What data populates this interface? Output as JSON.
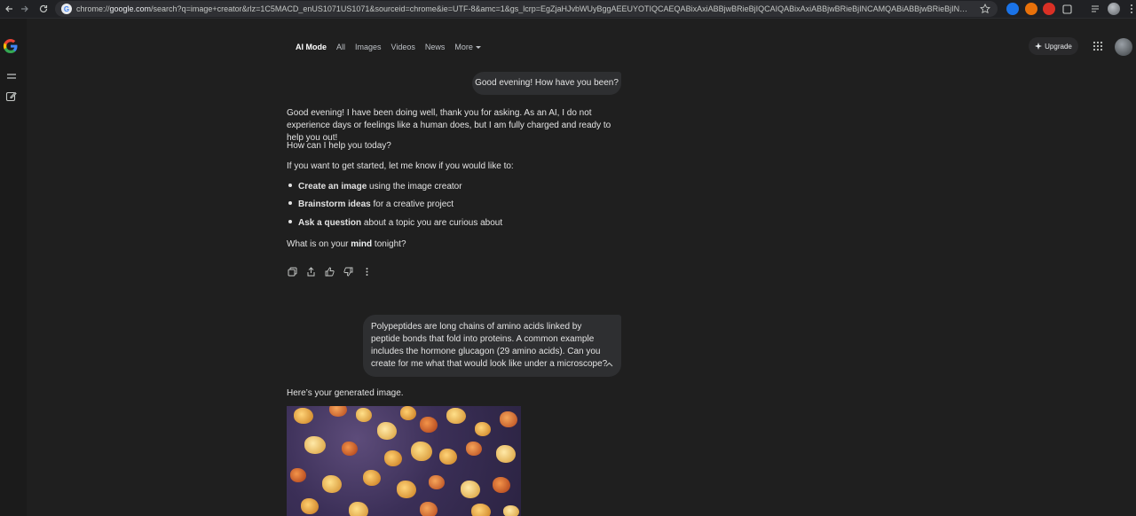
{
  "browser": {
    "url_prefix": "chrome://",
    "url_host": "google.com",
    "url_rest": "/search?q=image+creator&rlz=1C5MACD_enUS1071US1071&sourceid=chrome&ie=UTF-8&amc=1&gs_lcrp=EgZjaHJvbWUyBggAEEUYOTIQCAEQABixAxiABBjwBRieBjIQCAIQABixAxiABBjwBRieBjINCAMQABiABBjwBRieBjINCAQQABiABBjwBRieBjI..."
  },
  "tabs": [
    {
      "label": "AI Mode",
      "active": true
    },
    {
      "label": "All"
    },
    {
      "label": "Images"
    },
    {
      "label": "Videos"
    },
    {
      "label": "News"
    },
    {
      "label": "More"
    }
  ],
  "header": {
    "upgrade_label": "Upgrade"
  },
  "chat": {
    "user_msg_1": "Good evening! How have you been?",
    "resp_1_p1": "Good evening! I have been doing well, thank you for asking. As an AI, I do not experience days or feelings like a human does, but I am fully charged and ready to help you out!",
    "resp_1_p2": "How can I help you today?",
    "resp_1_p3": "If you want to get started, let me know if you would like to:",
    "list": [
      {
        "bold": "Create an image",
        "rest": " using the image creator"
      },
      {
        "bold": "Brainstorm ideas",
        "rest": " for a creative project"
      },
      {
        "bold": "Ask a question",
        "rest": " about a topic you are curious about"
      }
    ],
    "resp_1_p4_a": "What is on your ",
    "resp_1_p4_b": "mind",
    "resp_1_p4_c": " tonight?",
    "user_msg_2": "Polypeptides are long chains of amino acids linked by peptide bonds that fold into proteins. A common example includes the hormone glucagon (29 amino acids). Can you create for me what that would look like under a microscope?",
    "resp_2": "Here’s your generated image."
  },
  "icons": {
    "back": "arrow-left-icon",
    "forward": "arrow-right-icon",
    "reload": "reload-icon",
    "star": "star-icon",
    "menu": "menu-icon",
    "new_chat": "edit-icon",
    "copy": "copy-icon",
    "share": "share-icon",
    "thumbs_up": "thumbs-up-icon",
    "thumbs_down": "thumbs-down-icon",
    "more": "more-vert-icon",
    "apps": "apps-grid-icon"
  },
  "colors": {
    "background": "#1f1f1f",
    "bubble": "#2e2f31",
    "text": "#e3e3e3"
  }
}
